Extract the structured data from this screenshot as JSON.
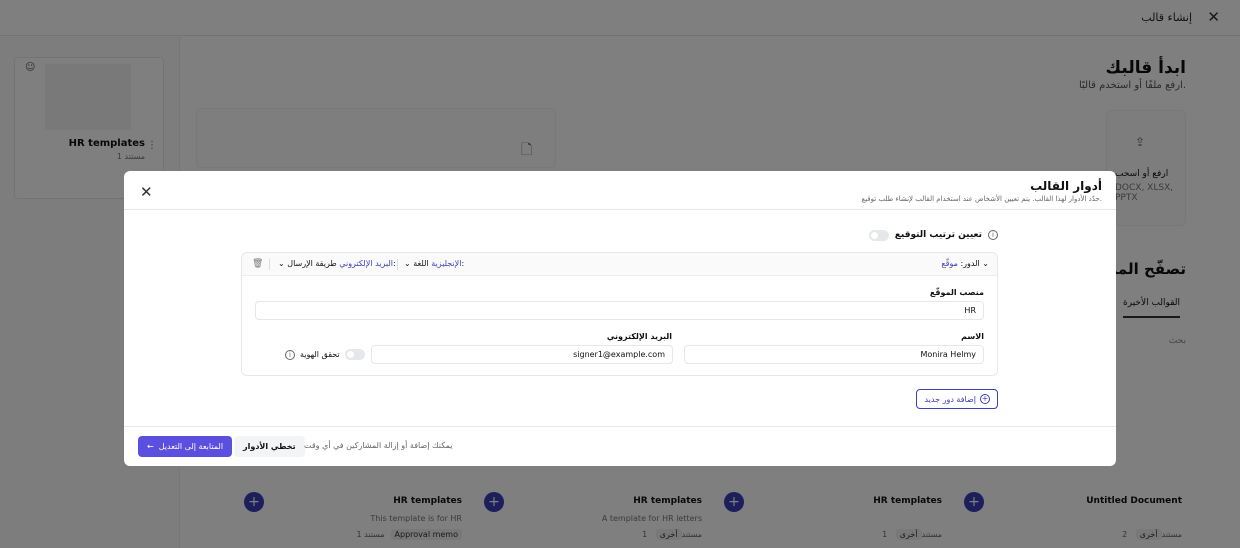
{
  "page": {
    "title": "إنشاء قالب",
    "close_icon": "x-icon"
  },
  "background": {
    "template_card": {
      "name": "HR templates",
      "count": "1 مستند"
    },
    "heading": "ابدأ قالبك",
    "sub": "ارفع ملفًا أو استخدم قالبًا.",
    "upload": {
      "line1": "ارفع أو اسحب",
      "line2": "DOCX, XLSX, PPTX"
    },
    "explore_heading": "تصفّح المزيد",
    "tab_recent": "القوالب الأخيرة",
    "search_placeholder": "بحث",
    "strip": [
      {
        "name": "HR templates",
        "desc": "This template is for HR",
        "count": "1 مستند",
        "tag": "Approval memo"
      },
      {
        "name": "HR templates",
        "desc": "A template for HR letters",
        "count": "1 مستند",
        "tag": "أخرى"
      },
      {
        "name": "HR templates",
        "desc": "",
        "count": "1 مستند",
        "tag": "أخرى"
      },
      {
        "name": "Untitled Document",
        "desc": "",
        "count": "2 مستند",
        "tag": "أخرى"
      }
    ]
  },
  "modal": {
    "title": "أدوار القالب",
    "description": "حدّد الأدوار لهذا القالب. يتم تعيين الأشخاص عند استخدام القالب لإنشاء طلب توقيع.",
    "signing_order_label": "تعيين ترتيب التوقيع",
    "role": {
      "role_prefix": "الدور:",
      "role_value": "موقّع",
      "language_prefix": "اللغة:",
      "language_value": "الإنجليزية",
      "send_prefix": "طريقة الإرسال:",
      "send_value": "البريد الإلكتروني",
      "position_label": "منصب الموقّع",
      "position_value": "HR",
      "name_label": "الاسم",
      "name_value": "Monira Helmy",
      "email_label": "البريد الإلكتروني",
      "email_value": "signer1@example.com",
      "identity_label": "تحقق الهوية"
    },
    "add_role_label": "إضافة دور جديد",
    "continue_label": "المتابعة إلى التعديل",
    "skip_label": "تخطي الأدوار",
    "footer_note": "يمكنك إضافة أو إزالة المشاركين في أي وقت"
  }
}
